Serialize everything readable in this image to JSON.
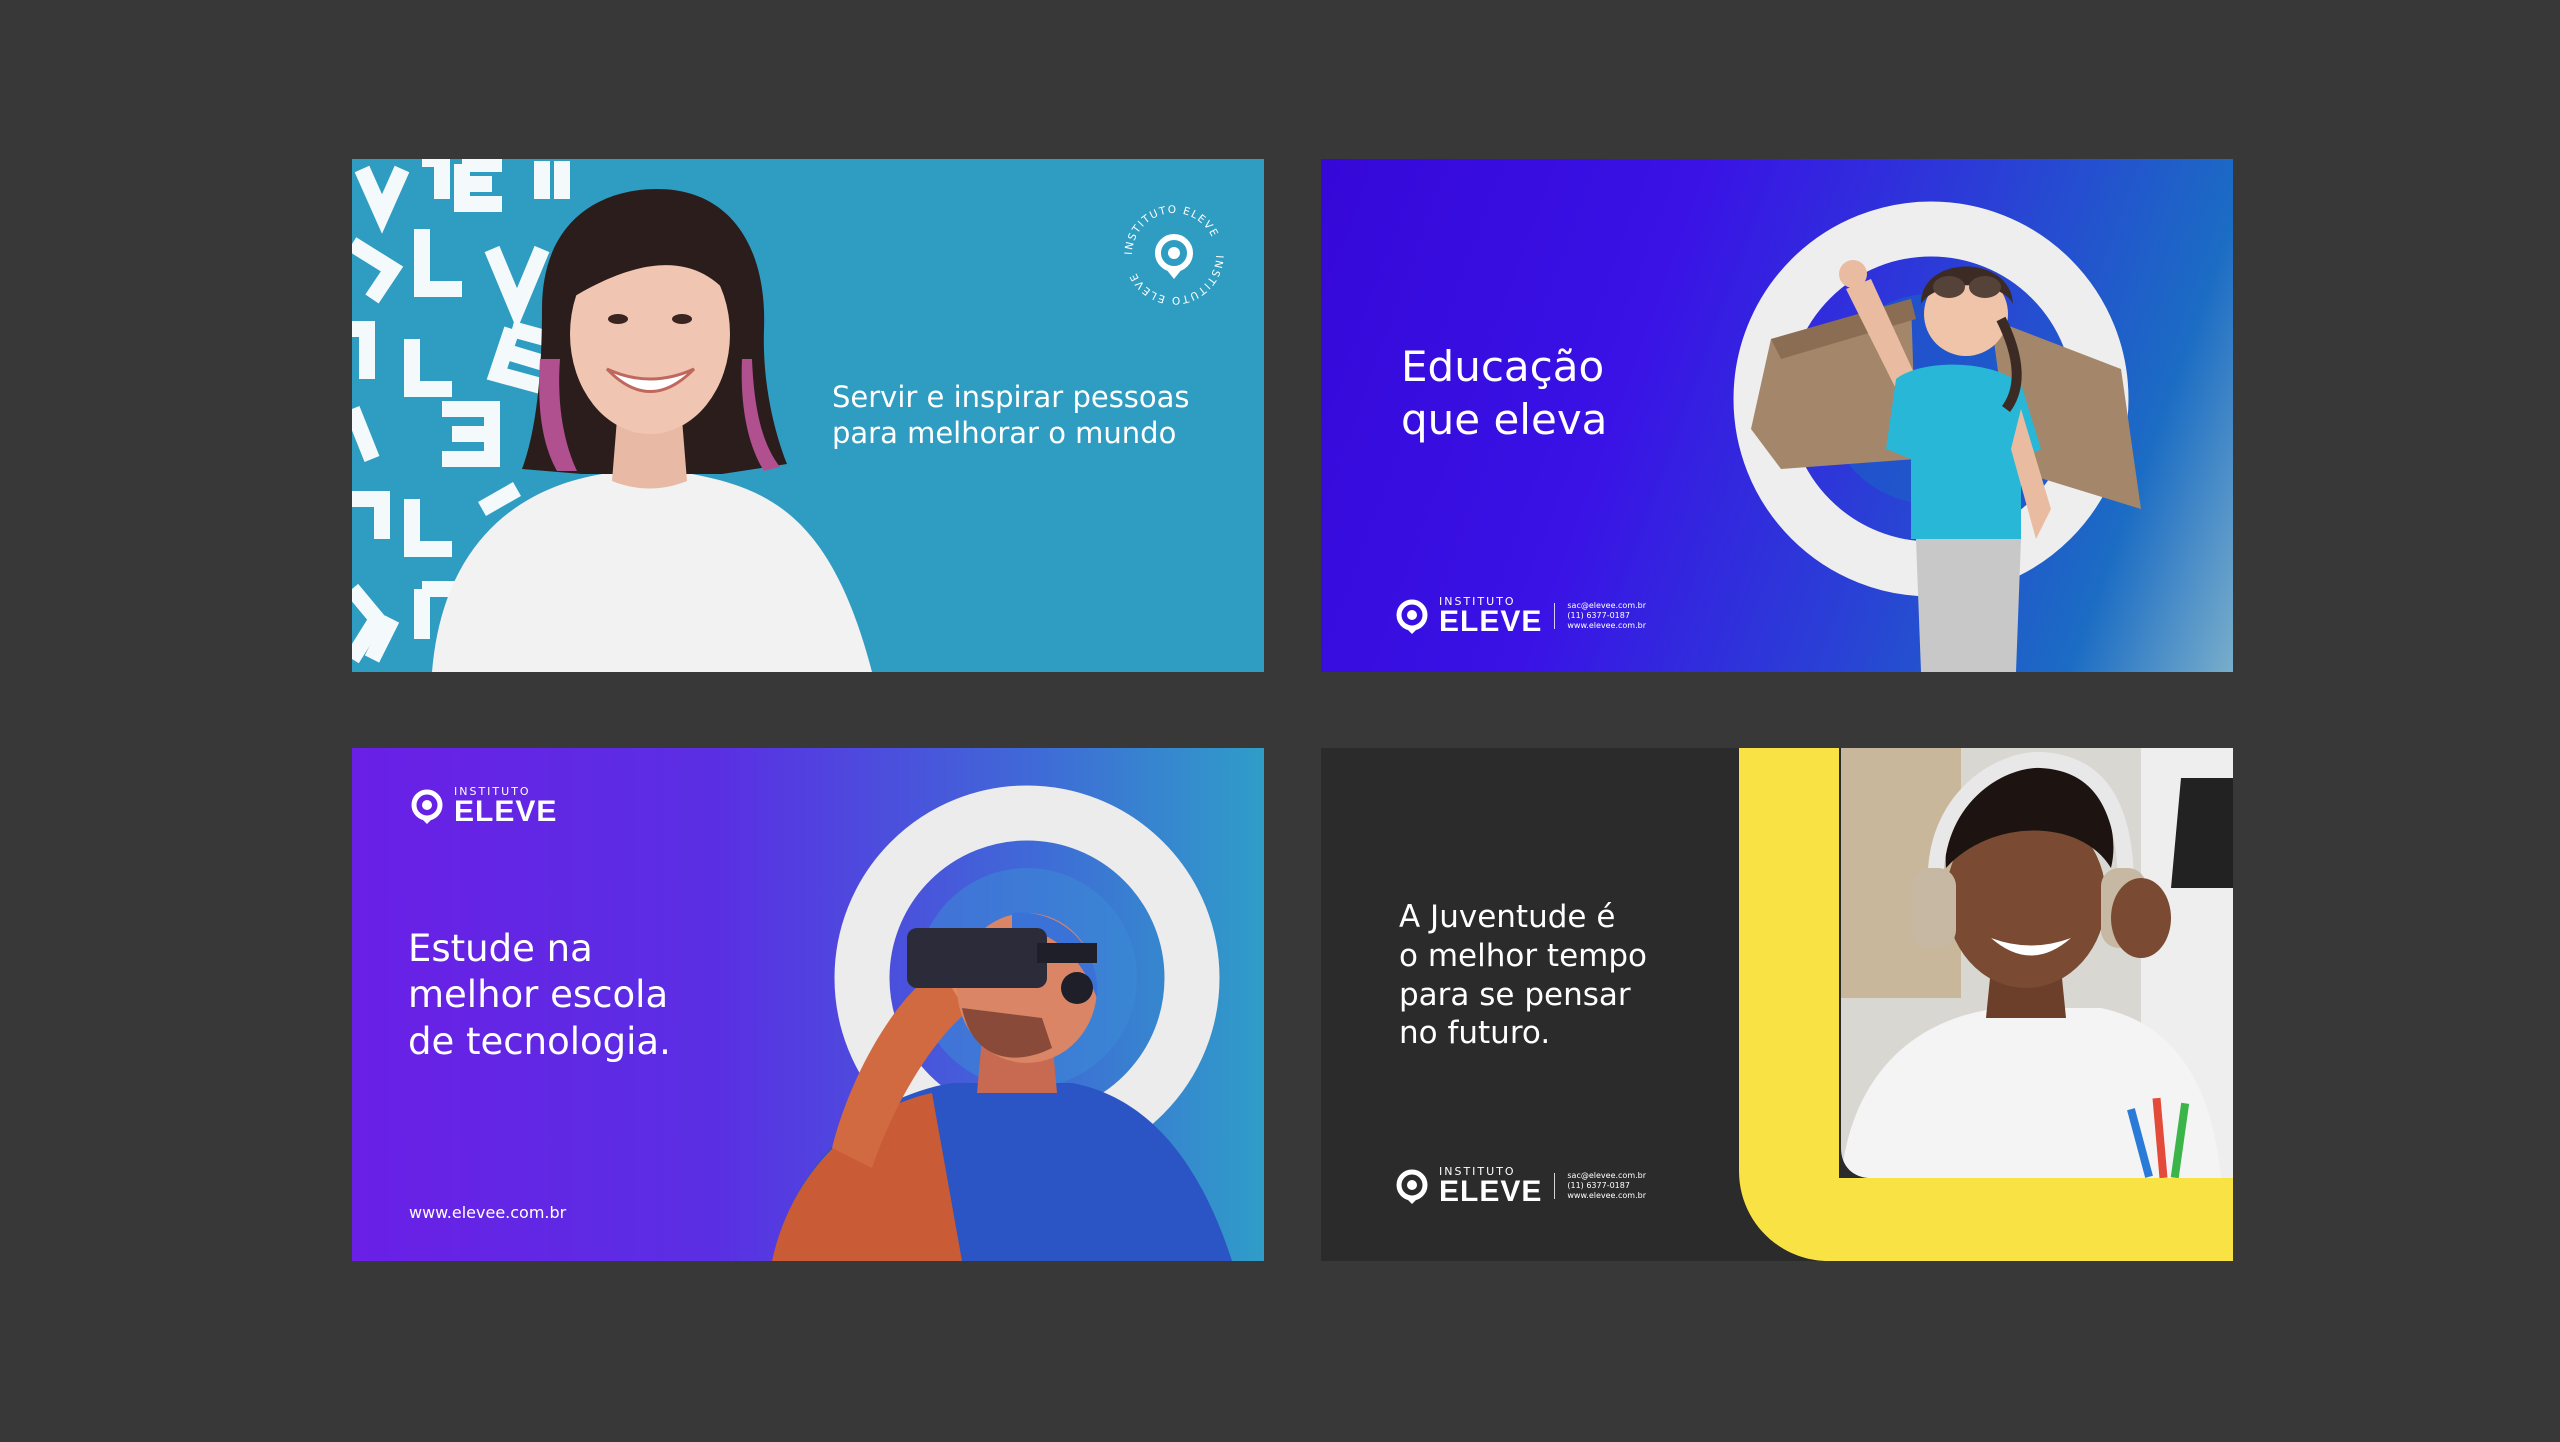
{
  "brand": {
    "round_logo_text": "INSTITUTO ELEVE",
    "lockup_small": "INSTITUTO",
    "lockup_big": "ELEVE",
    "contact_email": "sac@elevee.com.br",
    "contact_phone": "(11) 6377-0187",
    "contact_site": "www.elevee.com.br",
    "colors": {
      "teal": "#2f9dc2",
      "violet": "#3a12e6",
      "purple": "#6a1fe6",
      "yellow": "#f9e244",
      "dark": "#2b2b2b"
    }
  },
  "card1": {
    "headline_line1": "Servir e inspirar pessoas",
    "headline_line2": "para melhorar o mundo"
  },
  "card2": {
    "headline_line1": "Educação",
    "headline_line2": "que eleva"
  },
  "card3": {
    "headline_line1": "Estude na",
    "headline_line2": "melhor escola",
    "headline_line3": "de tecnologia.",
    "url": "www.elevee.com.br"
  },
  "card4": {
    "headline_line1": "A Juventude é",
    "headline_line2": "o melhor tempo",
    "headline_line3": "para se pensar",
    "headline_line4": "no futuro."
  }
}
